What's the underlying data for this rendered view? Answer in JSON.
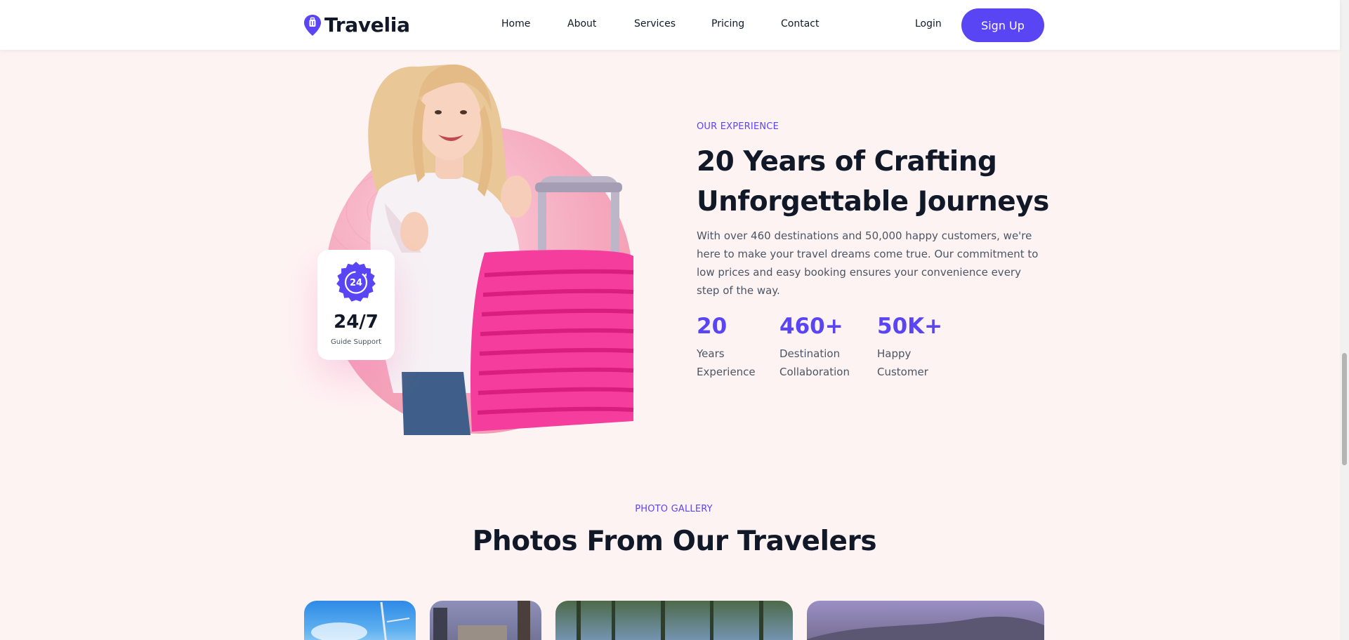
{
  "brand": {
    "name": "Travelia",
    "accent": "#5a45f5",
    "logo_icon": "map-pin-suitcase-icon"
  },
  "nav": {
    "links": [
      "Home",
      "About",
      "Services",
      "Pricing",
      "Contact"
    ],
    "login_label": "Login",
    "signup_label": "Sign Up"
  },
  "hero": {
    "badge": {
      "icon": "24-hour-support-seal-icon",
      "seal_text": "24",
      "title": "24/7",
      "subtitle": "Guide Support"
    },
    "eyebrow": "OUR EXPERIENCE",
    "title": "20 Years of Crafting Unforgettable Journeys",
    "description": "With over 460 destinations and 50,000 happy customers, we're here to make your travel dreams come true. Our commitment to low prices and easy booking ensures your convenience every step of the way.",
    "stats": [
      {
        "value": "20",
        "label": "Years Experience"
      },
      {
        "value": "460+",
        "label": "Destination Collaboration"
      },
      {
        "value": "50K+",
        "label": "Happy Customer"
      }
    ]
  },
  "gallery": {
    "eyebrow": "PHOTO GALLERY",
    "title": "Photos From Our Travelers"
  }
}
